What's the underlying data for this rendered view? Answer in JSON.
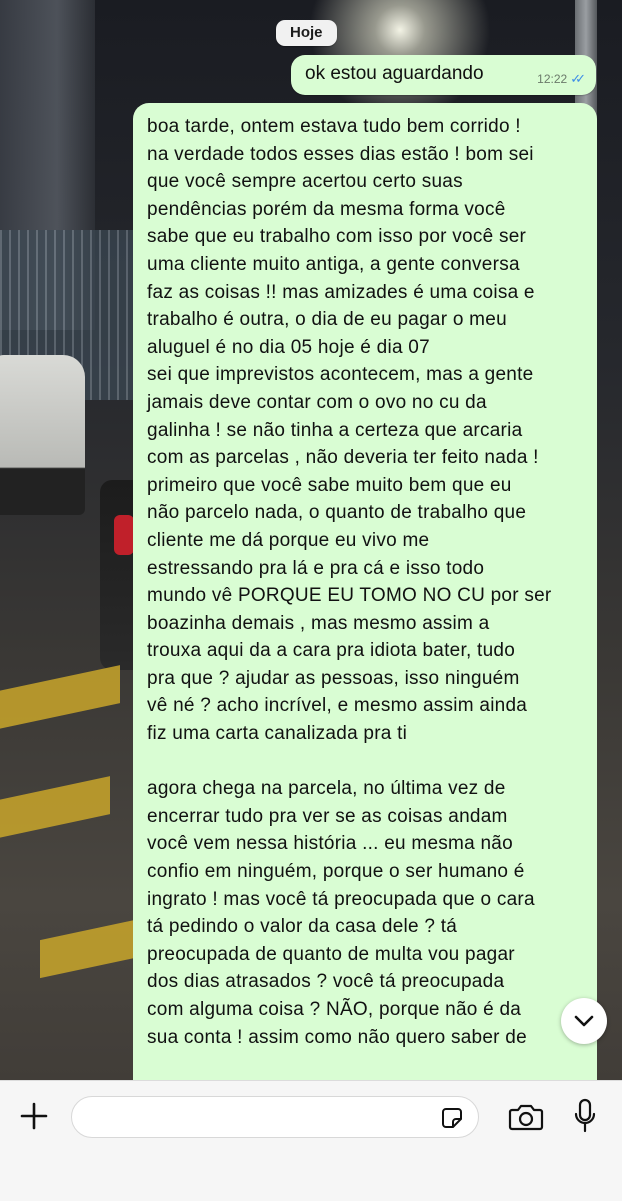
{
  "chat": {
    "date_label": "Hoje",
    "messages": [
      {
        "direction": "outgoing",
        "text": "ok estou aguardando",
        "time": "12:22",
        "status": "read"
      },
      {
        "direction": "incoming",
        "text": "boa tarde, ontem estava tudo bem corrido !\nna verdade todos esses dias estão ! bom sei\nque você sempre acertou certo suas\npendências porém da mesma forma você\nsabe que eu trabalho com isso por você ser\numa cliente muito antiga, a gente conversa\nfaz as coisas !! mas amizades é uma coisa e\ntrabalho é outra, o dia de eu pagar o meu\naluguel é no dia 05 hoje é dia 07\nsei que imprevistos acontecem, mas a gente\njamais deve contar com o ovo no cu da\ngalinha ! se não tinha a certeza que arcaria\ncom as parcelas , não deveria ter feito nada !\nprimeiro que você sabe muito bem que eu\nnão parcelo nada, o quanto de trabalho que\ncliente me dá porque eu vivo me\nestressando pra lá e pra cá e isso todo\nmundo vê PORQUE EU TOMO NO CU por ser\nboazinha demais , mas mesmo assim a\ntrouxa aqui da a cara pra idiota bater, tudo\npra que ? ajudar as pessoas, isso ninguém\nvê né ? acho incrível, e mesmo assim ainda\nfiz uma carta canalizada pra ti\n\nagora chega na parcela, no última vez de\nencerrar tudo pra ver se as coisas andam\nvocê vem nessa história ... eu mesma não\nconfio em ninguém, porque o ser humano é\ningrato ! mas você tá preocupada que o cara\ntá pedindo o valor da casa dele ? tá\npreocupada de quanto de multa vou pagar\ndos dias atrasados ? você tá preocupada\ncom alguma coisa ? NÃO, porque não é da\nsua conta ! assim como não quero saber de"
      }
    ]
  },
  "icons": {
    "read_ticks": "double-check-icon",
    "scroll_down": "chevron-down-icon",
    "attach": "plus-icon",
    "sticker": "sticker-icon",
    "camera": "camera-icon",
    "mic": "microphone-icon"
  },
  "colors": {
    "outgoing_bubble": "#d9fdd3",
    "read_ticks": "#3e8ee8",
    "input_bar": "#f6f6f6"
  },
  "composer": {
    "value": "",
    "placeholder": ""
  }
}
